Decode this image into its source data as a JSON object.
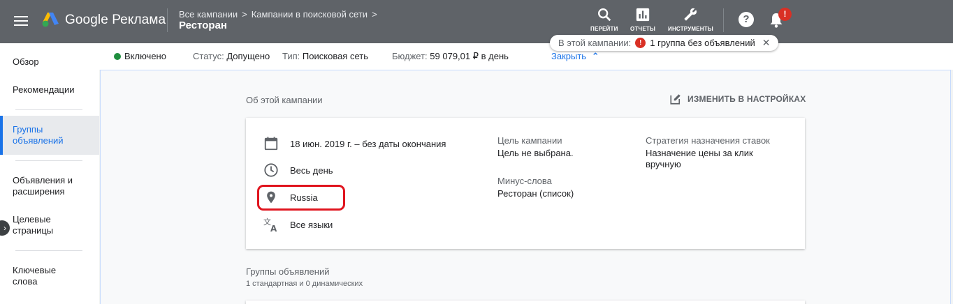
{
  "app": {
    "name": "Google Реклама",
    "breadcrumb": [
      "Все кампании",
      "Кампании в поисковой сети"
    ],
    "breadcrumb_sep": ">",
    "current": "Ресторан"
  },
  "toolbar": {
    "go_label": "ПЕРЕЙТИ",
    "reports_label": "ОТЧЕТЫ",
    "tools_label": "ИНСТРУМЕНТЫ",
    "help_glyph": "?",
    "notifications_badge": "!"
  },
  "alert": {
    "prefix": "В этой кампании:",
    "badge": "!",
    "message": "1 группа без объявлений",
    "close": "✕"
  },
  "sidebar": {
    "items": [
      {
        "label": "Обзор"
      },
      {
        "label": "Рекомендации"
      },
      {
        "label": "Группы объявлений",
        "active": true
      },
      {
        "label": "Объявления и расширения"
      },
      {
        "label": "Целевые страницы"
      },
      {
        "label": "Ключевые слова"
      }
    ],
    "collapse_glyph": "›"
  },
  "status": {
    "state": "Включено",
    "status_key": "Статус:",
    "status_val": "Допущено",
    "type_key": "Тип:",
    "type_val": "Поисковая сеть",
    "budget_key": "Бюджет:",
    "budget_val": "59 079,01 ₽ в день",
    "close_label": "Закрыть",
    "close_glyph": "⌃"
  },
  "about": {
    "title": "Об этой кампании",
    "edit_label": "ИЗМЕНИТЬ В НАСТРОЙКАХ",
    "dates": "18 июн. 2019 г. – без даты окончания",
    "schedule": "Весь день",
    "location": "Russia",
    "languages": "Все языки",
    "goal_label": "Цель кампании",
    "goal_value": "Цель не выбрана.",
    "negatives_label": "Минус-слова",
    "negatives_value": "Ресторан (список)",
    "bidding_label": "Стратегия назначения ставок",
    "bidding_value_1": "Назначение цены за клик",
    "bidding_value_2": "вручную"
  },
  "ad_groups": {
    "title": "Группы объявлений",
    "subtitle": "1 стандартная и 0 динамических"
  },
  "colors": {
    "topbar": "#5f6368",
    "accent": "#1a73e8",
    "active_status": "#1e8e3e",
    "error": "#d93025",
    "highlight": "#e0141e"
  }
}
